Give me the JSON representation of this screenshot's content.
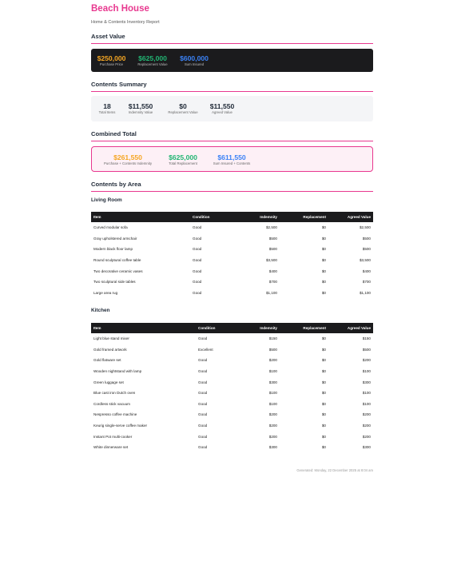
{
  "header": {
    "title": "Beach House",
    "subtitle": "Home & Contents Inventory Report"
  },
  "asset_value": {
    "heading": "Asset Value",
    "stats": [
      {
        "value": "$250,000",
        "label": "Purchase Price",
        "color": "#f5a623"
      },
      {
        "value": "$625,000",
        "label": "Replacement Value",
        "color": "#22b573"
      },
      {
        "value": "$600,000",
        "label": "Sum Insured",
        "color": "#3b82f6"
      }
    ]
  },
  "contents_summary": {
    "heading": "Contents Summary",
    "stats": [
      {
        "value": "18",
        "label": "Total Items"
      },
      {
        "value": "$11,550",
        "label": "Indemnity Value"
      },
      {
        "value": "$0",
        "label": "Replacement Value"
      },
      {
        "value": "$11,550",
        "label": "Agreed Value"
      }
    ]
  },
  "combined_total": {
    "heading": "Combined Total",
    "stats": [
      {
        "value": "$261,550",
        "label": "Purchase + Contents Indemnity",
        "color": "#f5a623"
      },
      {
        "value": "$625,000",
        "label": "Total Replacement",
        "color": "#22b573"
      },
      {
        "value": "$611,550",
        "label": "Sum Insured + Contents",
        "color": "#3b82f6"
      }
    ]
  },
  "contents_by_area": {
    "heading": "Contents by Area",
    "columns": [
      "Item",
      "Condition",
      "Indemnity",
      "Replacement",
      "Agreed Value"
    ],
    "areas": [
      {
        "name": "Living Room",
        "rows": [
          [
            "Curved modular sofa",
            "Good",
            "$2,500",
            "$0",
            "$2,500"
          ],
          [
            "Gray upholstered armchair",
            "Good",
            "$500",
            "$0",
            "$500"
          ],
          [
            "Modern black floor lamp",
            "Good",
            "$500",
            "$0",
            "$500"
          ],
          [
            "Round sculptural coffee table",
            "Good",
            "$3,500",
            "$0",
            "$3,500"
          ],
          [
            "Two decorative ceramic vases",
            "Good",
            "$400",
            "$0",
            "$400"
          ],
          [
            "Two sculptural side tables",
            "Good",
            "$700",
            "$0",
            "$700"
          ],
          [
            "Large area rug",
            "Good",
            "$1,100",
            "$0",
            "$1,100"
          ]
        ]
      },
      {
        "name": "Kitchen",
        "rows": [
          [
            "Light blue stand mixer",
            "Good",
            "$150",
            "$0",
            "$150"
          ],
          [
            "Gold framed artwork",
            "Excellent",
            "$500",
            "$0",
            "$500"
          ],
          [
            "Gold flatware set",
            "Good",
            "$200",
            "$0",
            "$200"
          ],
          [
            "Wooden nightstand with lamp",
            "Good",
            "$100",
            "$0",
            "$100"
          ],
          [
            "Green luggage set",
            "Good",
            "$300",
            "$0",
            "$300"
          ],
          [
            "Blue cast iron Dutch oven",
            "Good",
            "$100",
            "$0",
            "$100"
          ],
          [
            "Cordless stick vacuum",
            "Good",
            "$100",
            "$0",
            "$100"
          ],
          [
            "Nespresso coffee machine",
            "Good",
            "$200",
            "$0",
            "$200"
          ],
          [
            "Keurig single-serve coffee maker",
            "Good",
            "$200",
            "$0",
            "$200"
          ],
          [
            "Instant Pot multi-cooker",
            "Good",
            "$200",
            "$0",
            "$200"
          ],
          [
            "White dinnerware set",
            "Good",
            "$300",
            "$0",
            "$300"
          ]
        ]
      }
    ]
  },
  "footer": {
    "generated": "Generated: Monday, 22 December 2025 at 8:04 am"
  }
}
